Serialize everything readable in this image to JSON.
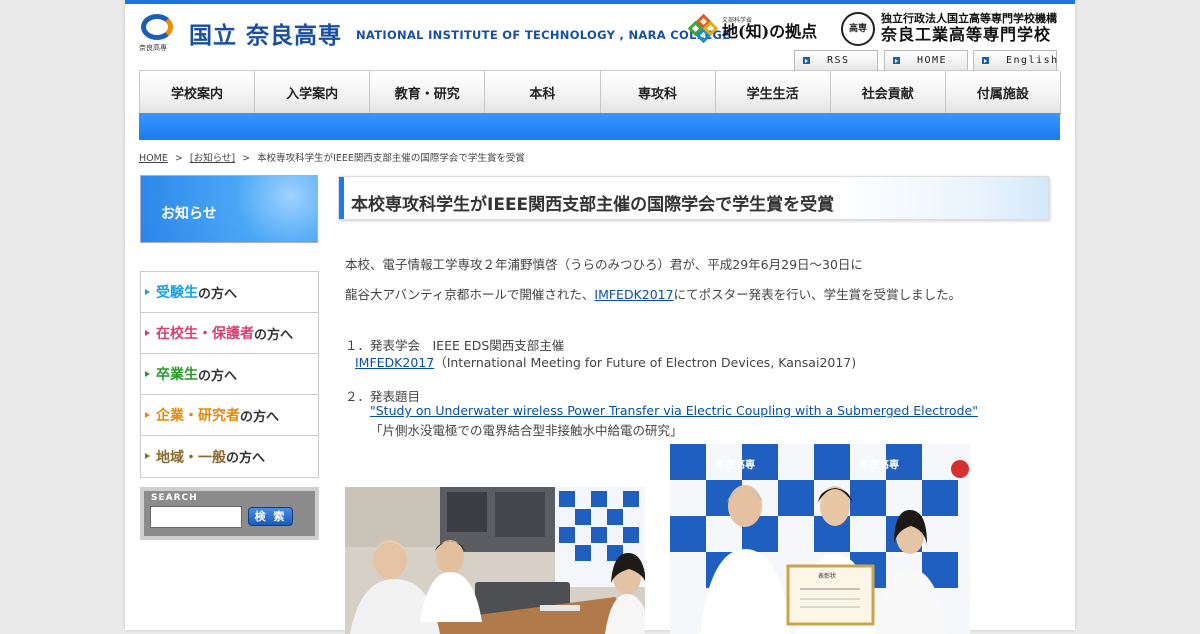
{
  "header": {
    "logo_jp": "国立 奈良高専",
    "logo_sub": "奈良高専",
    "logo_en": "NATIONAL INSTITUTE OF TECHNOLOGY , NARA COLLEGE",
    "coc_small": "文部科学省",
    "coc_main": "地(知)の拠点",
    "kosen_seal": "高専",
    "kosen_org": "独立行政法人国立高等専門学校機構",
    "kosen_name": "奈良工業高等専門学校",
    "util_links": [
      "RSS",
      "HOME",
      "English"
    ]
  },
  "nav": [
    "学校案内",
    "入学案内",
    "教育・研究",
    "本科",
    "専攻科",
    "学生生活",
    "社会貢献",
    "付属施設"
  ],
  "breadcrumb": {
    "home": "HOME",
    "sep": ">",
    "category": "[お知らせ]",
    "current": "本校専攻科学生がIEEE関西支部主催の国際学会で学生賞を受賞"
  },
  "sidebar": {
    "title": "お知らせ",
    "audiences": [
      {
        "hl": "受験生",
        "rest": "の方へ",
        "color": "#1aa0e0"
      },
      {
        "hl": "在校生・保護者",
        "rest": "の方へ",
        "color": "#d6406e"
      },
      {
        "hl": "卒業生",
        "rest": "の方へ",
        "color": "#2a9a2a"
      },
      {
        "hl": "企業・研究者",
        "rest": "の方へ",
        "color": "#e08a10"
      },
      {
        "hl": "地域・一般",
        "rest": "の方へ",
        "color": "#8a6a30"
      }
    ],
    "search_label": "SEARCH",
    "search_value": "",
    "search_button": "検 索"
  },
  "article": {
    "title": "本校専攻科学生がIEEE関西支部主催の国際学会で学生賞を受賞",
    "p1": "本校、電子情報工学専攻２年浦野慎啓（うらのみつひろ）君が、平成29年6月29日～30日に",
    "p2_pre": "龍谷大アバンティ京都ホールで開催された、",
    "p2_link": "IMFEDK2017",
    "p2_post": "にてポスター発表を行い、学生賞を受賞しました。",
    "item1_head": "１．発表学会　IEEE EDS関西支部主催",
    "item1_link": "IMFEDK2017",
    "item1_desc": "（International Meeting for Future of Electron Devices, Kansai2017)",
    "item2_head": "２．発表題目",
    "item2_link": "\"Study on Underwater wireless Power Transfer via Electric Coupling with a Submerged Electrode\"",
    "item2_jp": "「片側水没電極での電界結合型非接触水中給電の研究」"
  },
  "photos": {
    "photo2_banner": "奈良高専",
    "certificate_title": "表彰状"
  },
  "colors": {
    "accent": "#1a7cf0",
    "brand": "#1a4fa0",
    "link": "#0b4fa4"
  }
}
